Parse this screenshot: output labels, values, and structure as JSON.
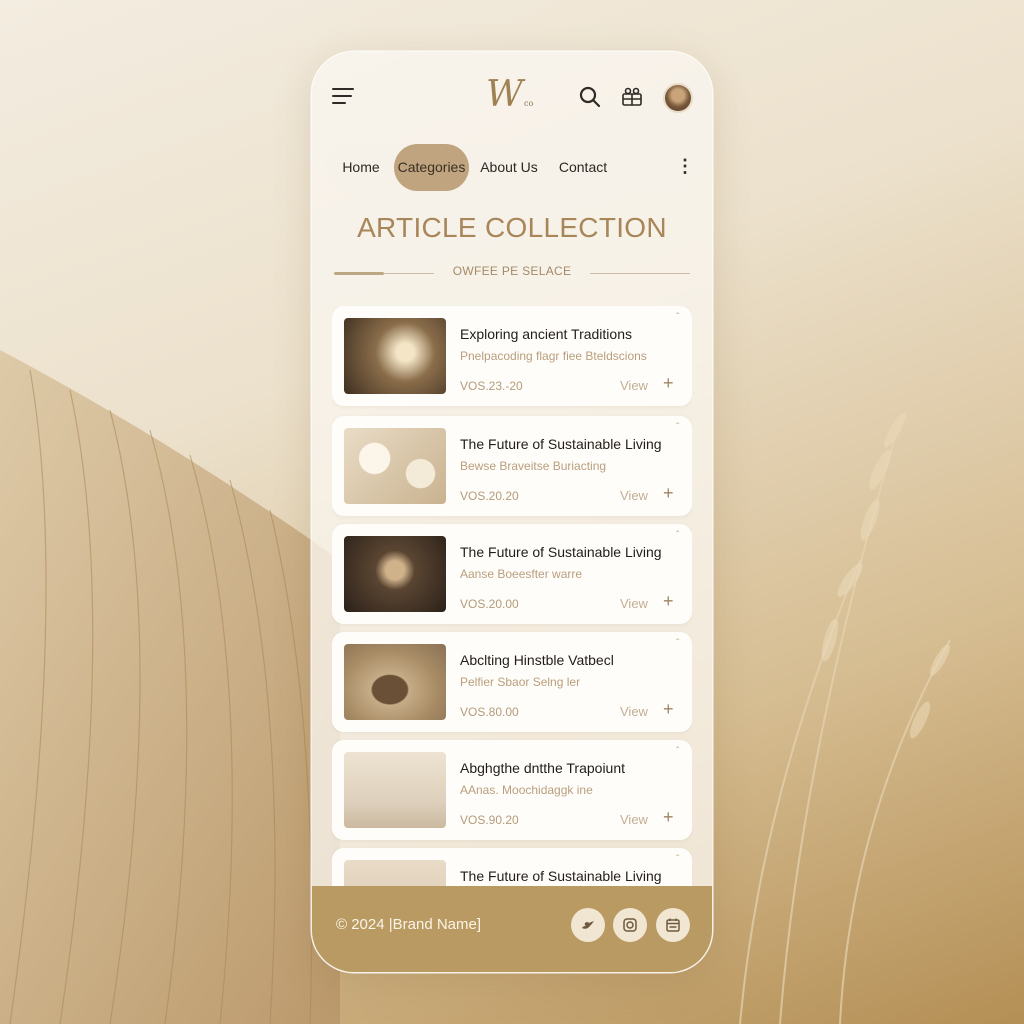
{
  "header": {
    "logo_text": "W",
    "logo_small": "co",
    "icons": [
      "menu-icon",
      "search-icon",
      "gift-icon"
    ]
  },
  "nav": {
    "items": [
      {
        "label": "Home"
      },
      {
        "label": "Categories",
        "active": true
      },
      {
        "label": "About Us"
      },
      {
        "label": "Contact"
      }
    ],
    "more": "⋮"
  },
  "section": {
    "title": "ARTICLE COLLECTION",
    "subtitle": "OWFEE PE SELACE"
  },
  "articles": [
    {
      "title": "Exploring ancient Traditions",
      "subtitle": "Pnelpacoding flagr fiee  Bteldscions",
      "date": "VOS.23.-20",
      "view": "View",
      "plus": "+"
    },
    {
      "title": "The Future of Sustainable Living",
      "subtitle": "Bewse Braveitse  Buriacting",
      "date": "VOS.20.20",
      "view": "View",
      "plus": "+"
    },
    {
      "title": "The Future of Sustainable Living",
      "subtitle": "Aanse Boeesfter warre",
      "date": "VOS.20.00",
      "view": "View",
      "plus": "+"
    },
    {
      "title": "Abclting Hinstble Vatbecl",
      "subtitle": "Pelfier Sbaor Selng ler",
      "date": "VOS.80.00",
      "view": "View",
      "plus": "+"
    },
    {
      "title": "Abghgthe dntthe Trapoiunt",
      "subtitle": "AAnas. Moochidaggk ine",
      "date": "VOS.90.20",
      "view": "View",
      "plus": "+"
    },
    {
      "title": "The Future of Sustainable Living",
      "subtitle": "",
      "date": "",
      "view": "",
      "plus": ""
    }
  ],
  "footer": {
    "copyright": "© 2024 |Brand Name]",
    "social": [
      "twitter-icon",
      "instagram-icon",
      "calendar-icon"
    ]
  },
  "colors": {
    "accent": "#a8865a",
    "nav_active": "#bfa47f",
    "footer": "#b99a62"
  }
}
